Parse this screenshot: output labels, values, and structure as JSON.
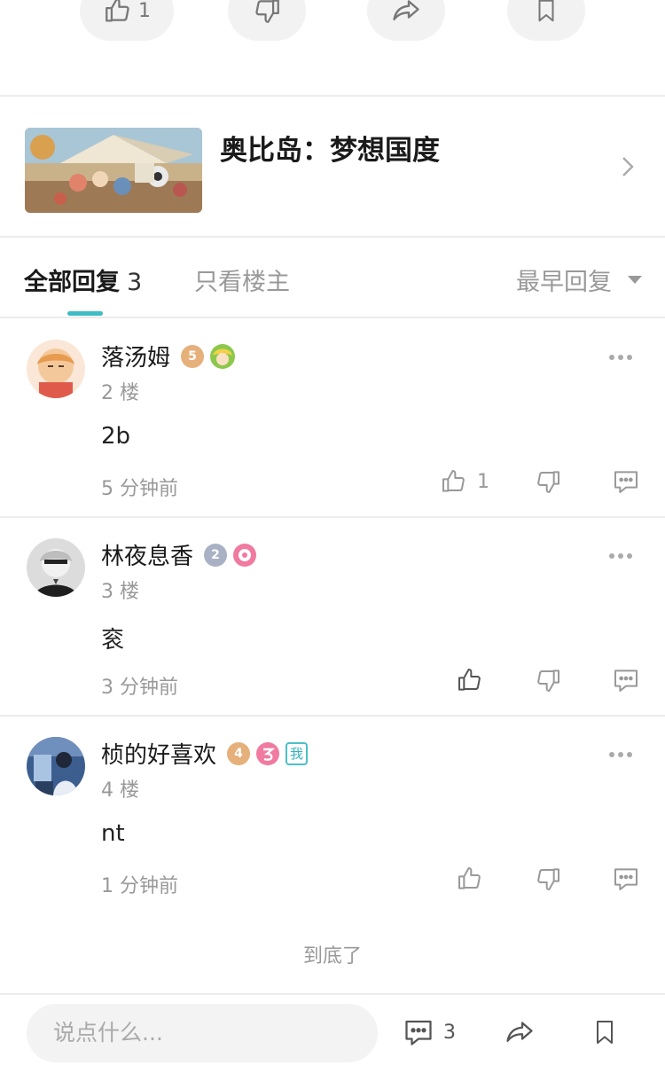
{
  "top_actions": {
    "like_count": "1"
  },
  "game": {
    "title": "奥比岛：梦想国度"
  },
  "tabs": {
    "all_label": "全部回复",
    "all_count": "3",
    "op_only_label": "只看楼主",
    "sort_label": "最早回复"
  },
  "comments": [
    {
      "username": "落汤姆",
      "level": "5",
      "floor": "2 楼",
      "text": "2b",
      "time": "5 分钟前",
      "like_count": "1"
    },
    {
      "username": "林夜息香",
      "level": "2",
      "floor": "3 楼",
      "text": "衮",
      "time": "3 分钟前",
      "like_count": ""
    },
    {
      "username": "桢的好喜欢",
      "level": "4",
      "floor": "4 楼",
      "text": "nt",
      "time": "1 分钟前",
      "like_count": "",
      "me_tag": "我"
    }
  ],
  "end_text": "到底了",
  "bottom_bar": {
    "input_placeholder": "说点什么...",
    "comment_count": "3"
  },
  "colors": {
    "accent": "#3fbcc6",
    "muted": "#999999",
    "gold_badge": "#e6b07a",
    "silver_badge": "#a9b2c4",
    "pink_badge": "#f07aa0"
  }
}
